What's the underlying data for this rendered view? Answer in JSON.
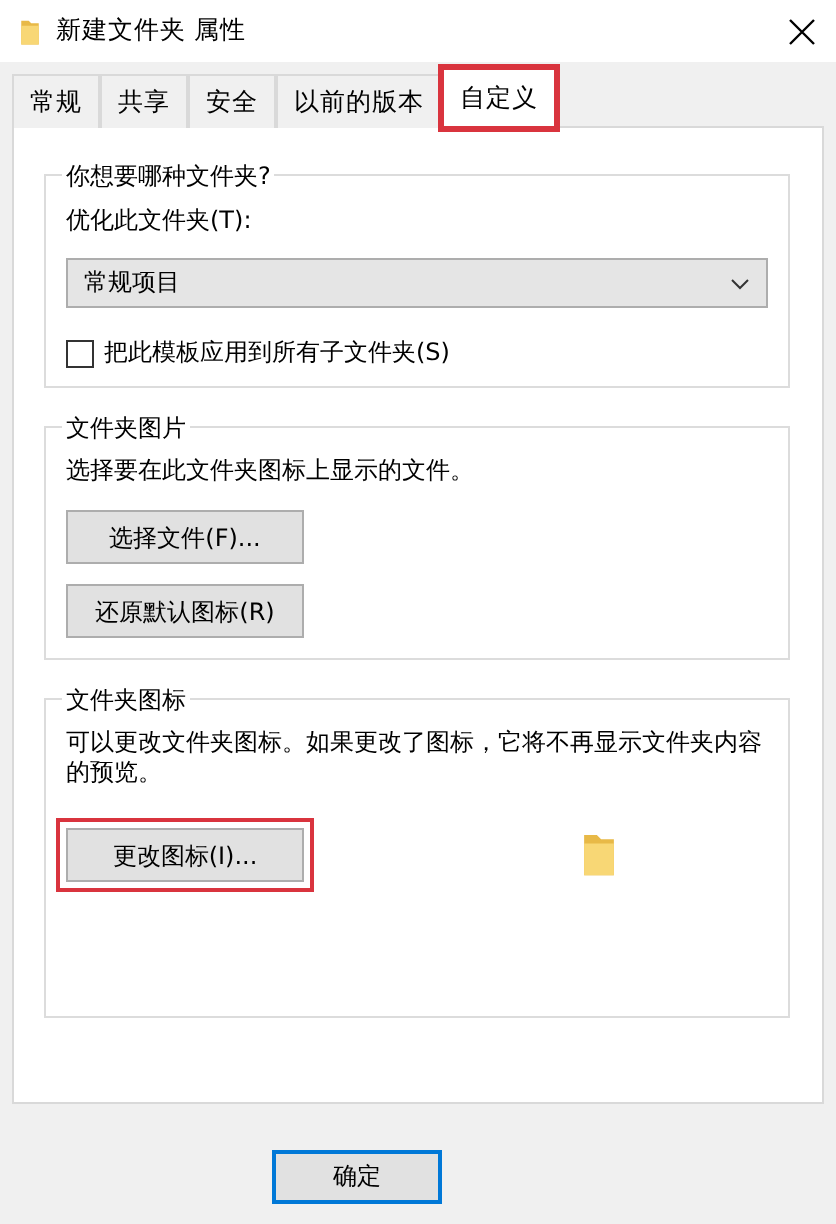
{
  "window": {
    "title": "新建文件夹 属性"
  },
  "tabs": [
    {
      "label": "常规",
      "selected": false,
      "highlighted": false
    },
    {
      "label": "共享",
      "selected": false,
      "highlighted": false
    },
    {
      "label": "安全",
      "selected": false,
      "highlighted": false
    },
    {
      "label": "以前的版本",
      "selected": false,
      "highlighted": false
    },
    {
      "label": "自定义",
      "selected": true,
      "highlighted": true
    }
  ],
  "folder_type": {
    "title": "你想要哪种文件夹?",
    "label": "优化此文件夹(T):",
    "dropdown": {
      "value": "常规项目"
    },
    "checkbox": {
      "label": "把此模板应用到所有子文件夹(S)",
      "checked": false
    }
  },
  "folder_pictures": {
    "title": "文件夹图片",
    "text": "选择要在此文件夹图标上显示的文件。",
    "buttons": [
      {
        "label": "选择文件(F)...",
        "highlighted": false
      },
      {
        "label": "还原默认图标(R)",
        "highlighted": false
      }
    ]
  },
  "folder_icons": {
    "title": "文件夹图标",
    "text": "可以更改文件夹图标。如果更改了图标，它将不再显示文件夹内容的预览。",
    "buttons": [
      {
        "label": "更改图标(I)...",
        "highlighted": true
      }
    ]
  },
  "buttons": [
    {
      "label": "确定",
      "default": true
    }
  ]
}
